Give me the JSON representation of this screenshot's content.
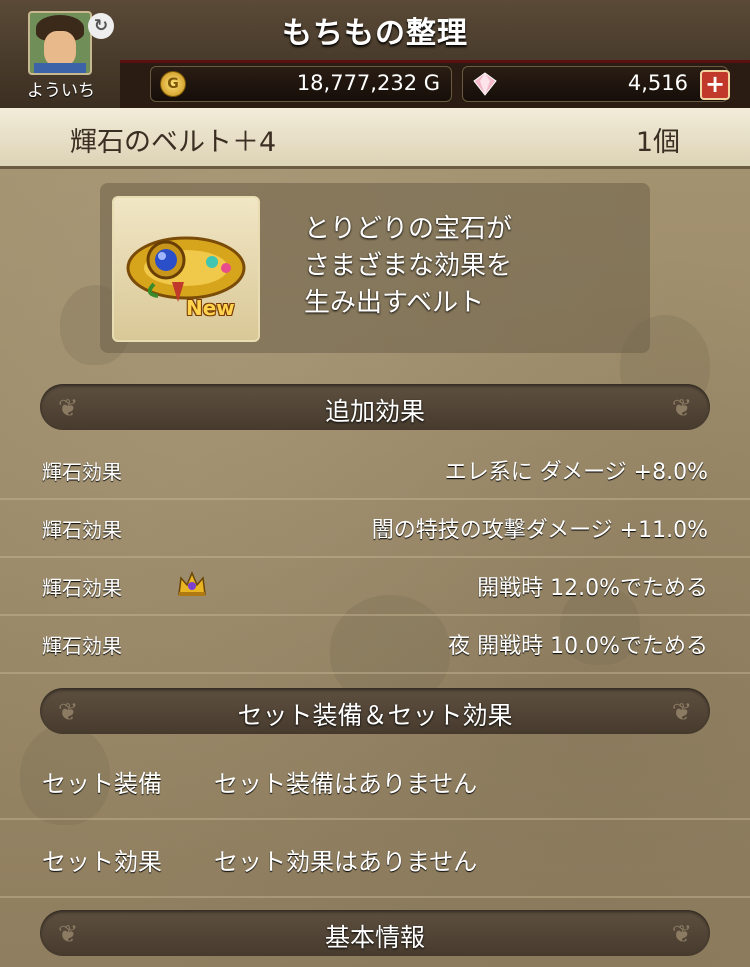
{
  "header": {
    "title": "もちもの整理",
    "player_name": "よういち",
    "gold_icon_text": "G",
    "gold": "18,777,232 G",
    "gems": "4,516",
    "plus_label": "+"
  },
  "item": {
    "name": "輝石のベルト＋4",
    "count": "1個",
    "new_badge": "New",
    "description_lines": [
      "とりどりの宝石が",
      "さまざまな効果を",
      "生み出すベルト"
    ]
  },
  "sections": {
    "extra_effects_title": "追加効果",
    "set_title": "セット装備＆セット効果",
    "basic_info_title": "基本情報"
  },
  "effects": [
    {
      "label": "輝石効果",
      "value": "エレ系に  ダメージ  +8.0%"
    },
    {
      "label": "輝石効果",
      "value": "闇の特技の攻撃ダメージ  +11.0%"
    },
    {
      "label": "輝石効果",
      "value": "開戦時  12.0%でためる"
    },
    {
      "label": "輝石効果",
      "value": "夜  開戦時  10.0%でためる"
    }
  ],
  "set_rows": [
    {
      "label": "セット装備",
      "value": "セット装備はありません"
    },
    {
      "label": "セット効果",
      "value": "セット効果はありません"
    }
  ],
  "icons": {
    "swap": "swap-icon",
    "gold": "gold-coin-icon",
    "gem": "gem-icon",
    "crown": "crown-icon",
    "item": "belt-icon"
  },
  "colors": {
    "header_bg": "#3b2f22",
    "plus_button": "#c0392b",
    "new_badge": "#ffd34d"
  }
}
